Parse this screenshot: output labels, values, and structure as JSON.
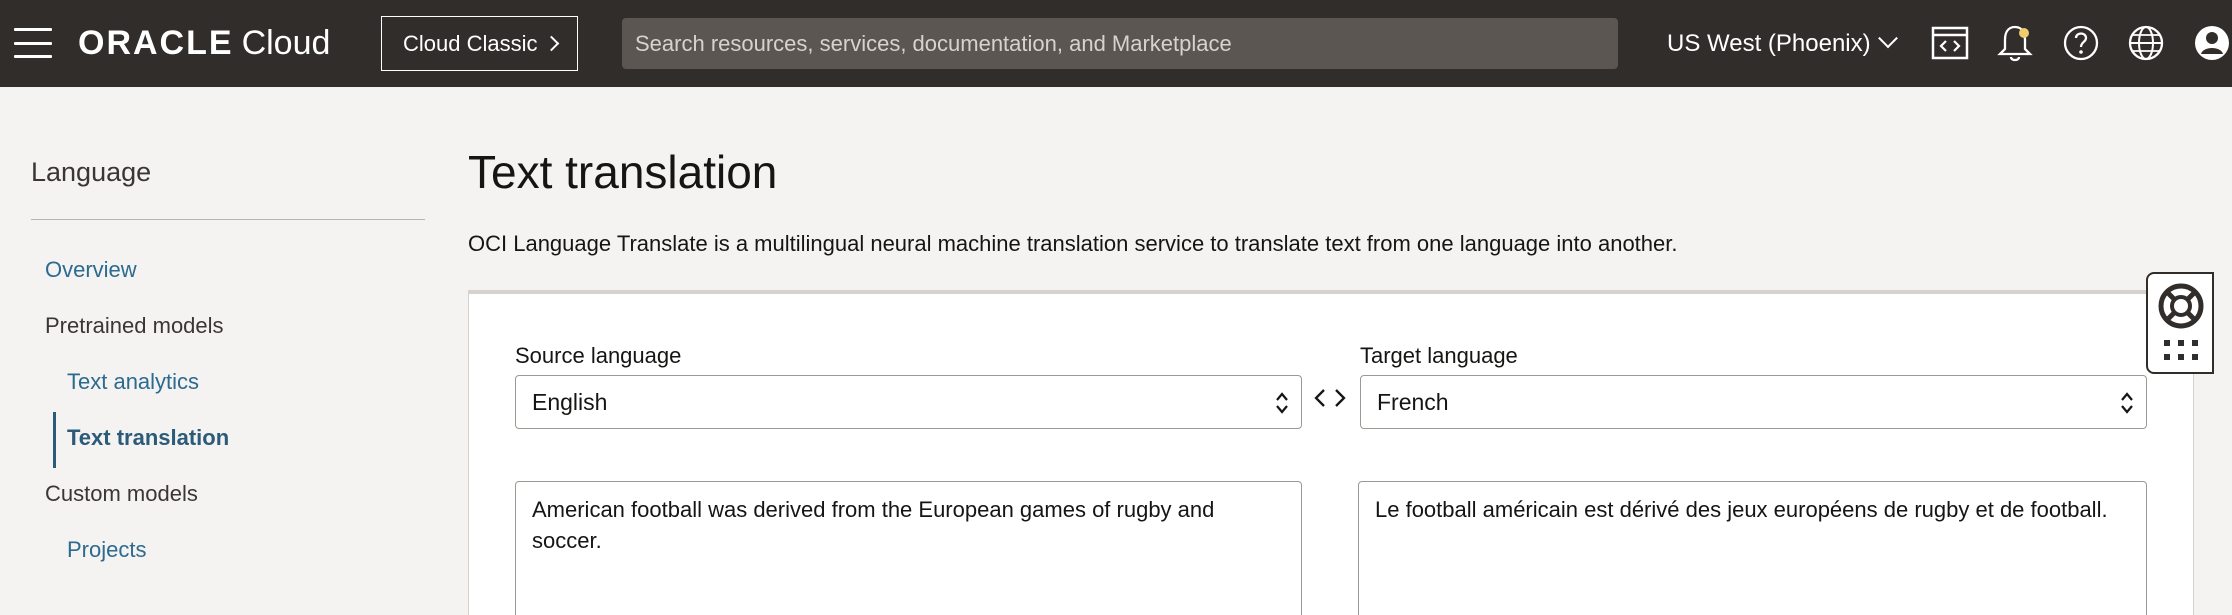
{
  "topbar": {
    "brand_oracle": "ORACLE",
    "brand_cloud": "Cloud",
    "classic_button": "Cloud Classic",
    "search_placeholder": "Search resources, services, documentation, and Marketplace",
    "region": "US West (Phoenix)",
    "icons": [
      "menu-icon",
      "code-editor-icon",
      "notifications-icon",
      "help-icon",
      "language-globe-icon",
      "profile-icon"
    ]
  },
  "sidebar": {
    "title": "Language",
    "items": [
      {
        "label": "Overview",
        "style": "link"
      },
      {
        "label": "Pretrained models",
        "style": "section"
      },
      {
        "label": "Text analytics",
        "style": "link"
      },
      {
        "label": "Text translation",
        "style": "active"
      },
      {
        "label": "Custom models",
        "style": "section"
      },
      {
        "label": "Projects",
        "style": "link"
      }
    ]
  },
  "main": {
    "title": "Text translation",
    "description": "OCI Language Translate is a multilingual neural machine translation service to translate text from one language into another.",
    "source_label": "Source language",
    "source_value": "English",
    "target_label": "Target language",
    "target_value": "French",
    "source_text": "American football was derived from the European games of rugby and soccer.",
    "target_text": "Le football américain est dérivé des jeux européens de rugby et de football."
  },
  "colors": {
    "topbar_bg": "#312d2a",
    "link": "#2c6a8f",
    "active": "#2b5b79",
    "notification_dot": "#f0cc71"
  }
}
